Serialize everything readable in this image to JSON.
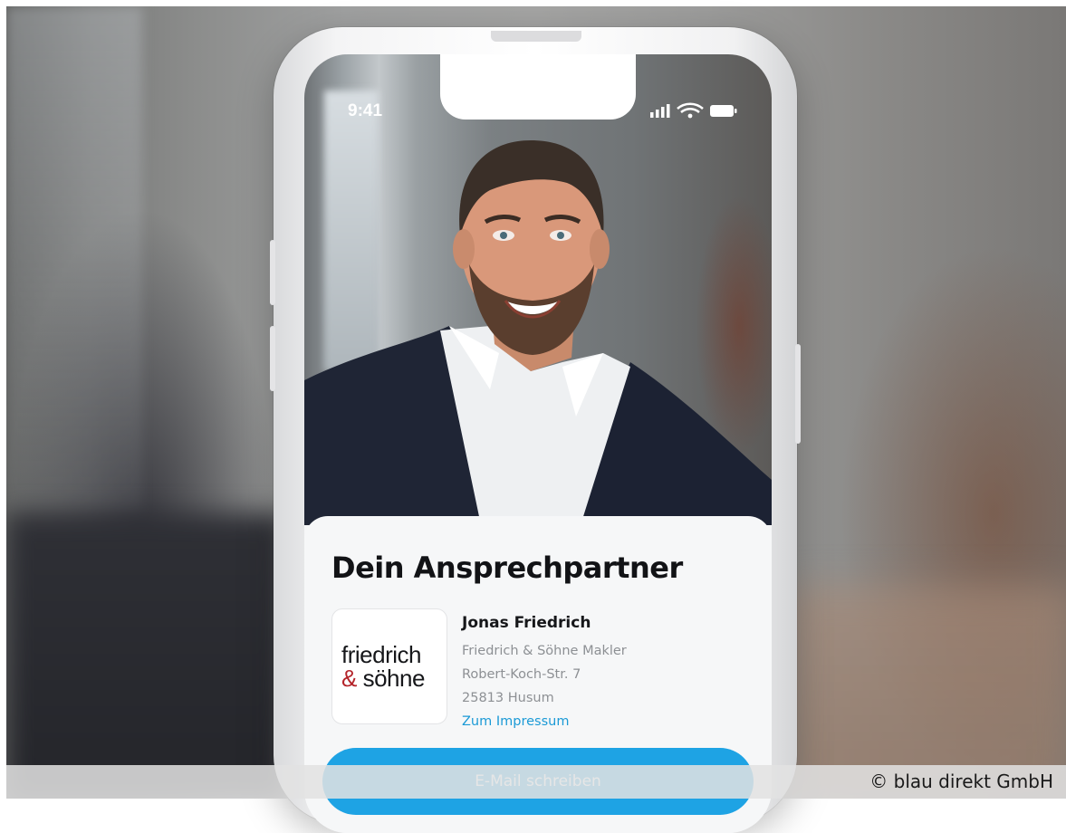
{
  "status_bar": {
    "time": "9:41"
  },
  "contact_card": {
    "title": "Dein Ansprechpartner",
    "logo": {
      "line1": "friedrich",
      "line2_amp": "&",
      "line2_rest": " söhne"
    },
    "name": "Jonas Friedrich",
    "company": "Friedrich & Söhne Makler",
    "street": "Robert-Koch-Str. 7",
    "city": "25813 Husum",
    "impressum_link": "Zum Impressum",
    "email_button": "E-Mail schreiben"
  },
  "caption": "© blau direkt GmbH",
  "colors": {
    "accent_blue": "#1ea3e4",
    "link_blue": "#1b9ad6",
    "logo_amp_red": "#b4242a"
  },
  "icons": [
    "cellular-signal-icon",
    "wifi-icon",
    "battery-icon"
  ]
}
